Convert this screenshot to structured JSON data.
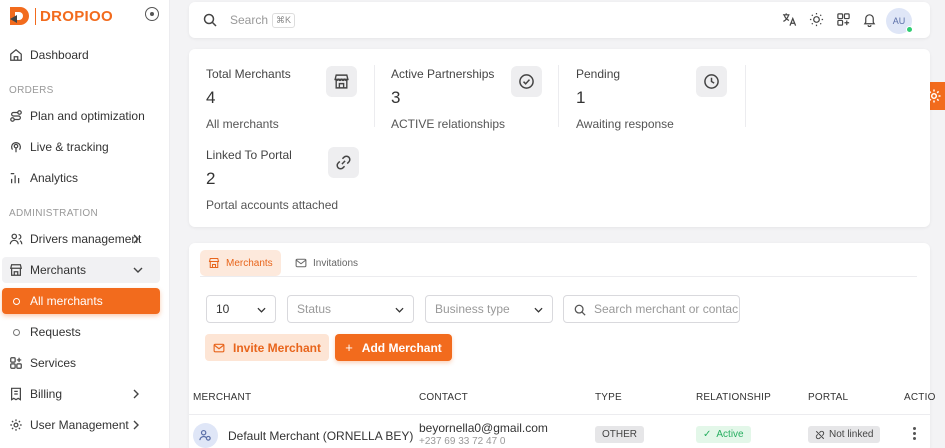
{
  "brand": {
    "name": "DROPIOO",
    "accent": "#f26b1d"
  },
  "sidebar": {
    "dashboard": "Dashboard",
    "section_orders": "ORDERS",
    "plan": "Plan and optimization",
    "live": "Live & tracking",
    "analytics": "Analytics",
    "section_admin": "ADMINISTRATION",
    "drivers": "Drivers management",
    "merchants": "Merchants",
    "all_merchants": "All merchants",
    "requests": "Requests",
    "services": "Services",
    "billing": "Billing",
    "user_management": "User Management"
  },
  "header": {
    "search_placeholder": "Search",
    "search_shortcut": "⌘K",
    "avatar_initials": "AU"
  },
  "stats": [
    {
      "label": "Total Merchants",
      "value": "4",
      "sub": "All merchants",
      "icon": "store-icon"
    },
    {
      "label": "Active Partnerships",
      "value": "3",
      "sub": "ACTIVE relationships",
      "icon": "check-circle-icon"
    },
    {
      "label": "Pending",
      "value": "1",
      "sub": "Awaiting response",
      "icon": "clock-icon"
    },
    {
      "label": "Linked To Portal",
      "value": "2",
      "sub": "Portal accounts attached",
      "icon": "link-icon"
    }
  ],
  "tabs": {
    "merchants": "Merchants",
    "invitations": "Invitations"
  },
  "filters": {
    "page_size": "10",
    "status_placeholder": "Status",
    "business_type_placeholder": "Business type",
    "search_placeholder": "Search merchant or contac"
  },
  "actions": {
    "invite": "Invite Merchant",
    "add": "Add Merchant"
  },
  "table": {
    "headers": {
      "merchant": "MERCHANT",
      "contact": "CONTACT",
      "type": "TYPE",
      "relationship": "RELATIONSHIP",
      "portal": "PORTAL",
      "actions": "ACTIO"
    },
    "rows": [
      {
        "merchant": "Default Merchant (ORNELLA BEY)",
        "email": "beyornella0@gmail.com",
        "phone": "+237 69 33 72 47 0",
        "type": "OTHER",
        "relationship": "Active",
        "portal": "Not linked"
      }
    ]
  }
}
